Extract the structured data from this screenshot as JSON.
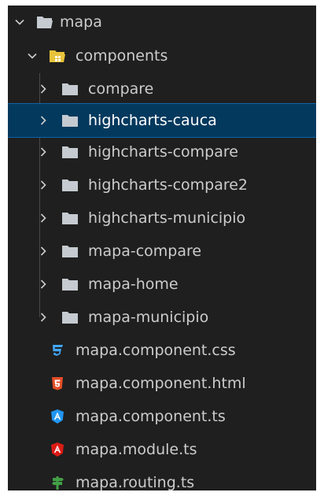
{
  "tree": {
    "root": {
      "label": "mapa",
      "icon": "folder-open-icon",
      "expanded": true
    },
    "components": {
      "label": "components",
      "icon": "components-folder-icon",
      "expanded": true
    },
    "subfolders": [
      {
        "label": "compare",
        "icon": "folder-icon",
        "expanded": false,
        "selected": false
      },
      {
        "label": "highcharts-cauca",
        "icon": "folder-icon",
        "expanded": false,
        "selected": true
      },
      {
        "label": "highcharts-compare",
        "icon": "folder-icon",
        "expanded": false,
        "selected": false
      },
      {
        "label": "highcharts-compare2",
        "icon": "folder-icon",
        "expanded": false,
        "selected": false
      },
      {
        "label": "highcharts-municipio",
        "icon": "folder-icon",
        "expanded": false,
        "selected": false
      },
      {
        "label": "mapa-compare",
        "icon": "folder-icon",
        "expanded": false,
        "selected": false
      },
      {
        "label": "mapa-home",
        "icon": "folder-icon",
        "expanded": false,
        "selected": false
      },
      {
        "label": "mapa-municipio",
        "icon": "folder-icon",
        "expanded": false,
        "selected": false
      }
    ],
    "files": [
      {
        "label": "mapa.component.css",
        "icon": "css3-icon"
      },
      {
        "label": "mapa.component.html",
        "icon": "html5-icon"
      },
      {
        "label": "mapa.component.ts",
        "icon": "angular-component-icon"
      },
      {
        "label": "mapa.module.ts",
        "icon": "angular-module-icon"
      },
      {
        "label": "mapa.routing.ts",
        "icon": "routing-signpost-icon"
      }
    ]
  },
  "colors": {
    "background": "#1f1f1f",
    "text": "#cccccc",
    "selection": "#04395e",
    "selection_border": "#0e63a6",
    "folder": "#c5cbd0",
    "components_folder": "#e8c33a",
    "css": "#42a5f5",
    "html": "#e44d26",
    "angular_component": "#2196f3",
    "angular_module": "#dd1b16",
    "routing": "#43a047"
  }
}
